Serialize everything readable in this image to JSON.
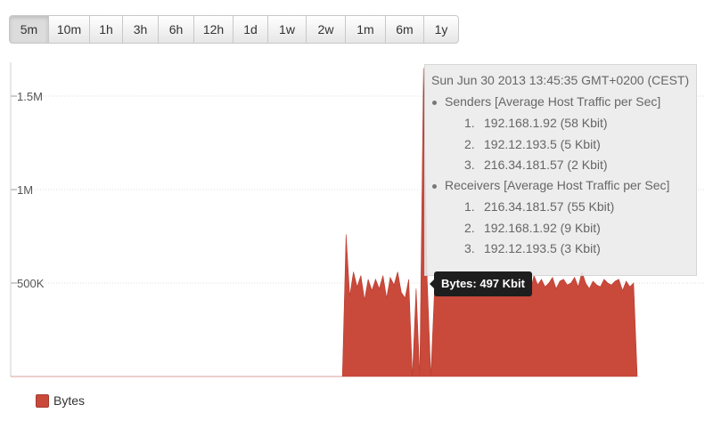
{
  "timerange": {
    "buttons": [
      "5m",
      "10m",
      "1h",
      "3h",
      "6h",
      "12h",
      "1d",
      "1w",
      "2w",
      "1m",
      "6m",
      "1y"
    ],
    "selected": "5m"
  },
  "colors": {
    "series": "#c9493b",
    "axis": "#cfcfcf",
    "grid": "#dddddd"
  },
  "tooltip": {
    "time": "Sun Jun 30 2013 13:45:35 GMT+0200 (CEST)",
    "groups": [
      {
        "title": "Senders [Average Host Traffic per Sec]",
        "items": [
          {
            "rank": "1.",
            "text": "192.168.1.92 (58 Kbit)"
          },
          {
            "rank": "2.",
            "text": "192.12.193.5 (5 Kbit)"
          },
          {
            "rank": "3.",
            "text": "216.34.181.57 (2 Kbit)"
          }
        ]
      },
      {
        "title": "Receivers [Average Host Traffic per Sec]",
        "items": [
          {
            "rank": "1.",
            "text": "216.34.181.57 (55 Kbit)"
          },
          {
            "rank": "2.",
            "text": "192.168.1.92 (9 Kbit)"
          },
          {
            "rank": "3.",
            "text": "192.12.193.5 (3 Kbit)"
          }
        ]
      }
    ]
  },
  "hover_flag": "Bytes: 497 Kbit",
  "legend": {
    "label": "Bytes",
    "icon": "legend-swatch-icon"
  },
  "chart_data": {
    "type": "area",
    "series": [
      {
        "name": "Bytes",
        "values": [
          0,
          0,
          0,
          0,
          0,
          0,
          0,
          0,
          0,
          0,
          0,
          0,
          0,
          0,
          0,
          0,
          0,
          0,
          0,
          0,
          0,
          0,
          0,
          0,
          0,
          0,
          0,
          0,
          0,
          0,
          0,
          0,
          0,
          0,
          0,
          0,
          0,
          0,
          0,
          0,
          0,
          0,
          0,
          0,
          0,
          0,
          0,
          0,
          0,
          0,
          0,
          0,
          0,
          0,
          0,
          0,
          0,
          0,
          0,
          0,
          0,
          0,
          0,
          0,
          0,
          0,
          0,
          0,
          0,
          0,
          0,
          0,
          0,
          0,
          0,
          0,
          0,
          0,
          0,
          0,
          0,
          0,
          0,
          0,
          0,
          0,
          0,
          0,
          0,
          0,
          0,
          760000,
          430000,
          560000,
          480000,
          540000,
          410000,
          520000,
          460000,
          520000,
          470000,
          540000,
          420000,
          530000,
          490000,
          560000,
          450000,
          420000,
          520000,
          0,
          470000,
          0,
          1650000,
          520000,
          0,
          470000,
          500000,
          540000,
          430000,
          560000,
          500000,
          480000,
          520000,
          497000,
          510000,
          520000,
          490000,
          480000,
          530000,
          460000,
          500000,
          470000,
          510000,
          490000,
          520000,
          530000,
          500000,
          520000,
          480000,
          510000,
          500000,
          460000,
          540000,
          490000,
          520000,
          480000,
          500000,
          530000,
          470000,
          510000,
          520000,
          490000,
          500000,
          530000,
          480000,
          560000,
          500000,
          470000,
          510000,
          490000,
          480000,
          520000,
          500000,
          490000,
          510000,
          520000,
          460000,
          510000,
          480000,
          500000,
          0
        ]
      }
    ],
    "yticks": [
      {
        "v": 500000,
        "label": "500K"
      },
      {
        "v": 1000000,
        "label": "1M"
      },
      {
        "v": 1500000,
        "label": "1.5M"
      }
    ],
    "ylim": [
      0,
      1650000
    ],
    "grid": "horizontal dotted",
    "legend_position": "bottom-left"
  }
}
